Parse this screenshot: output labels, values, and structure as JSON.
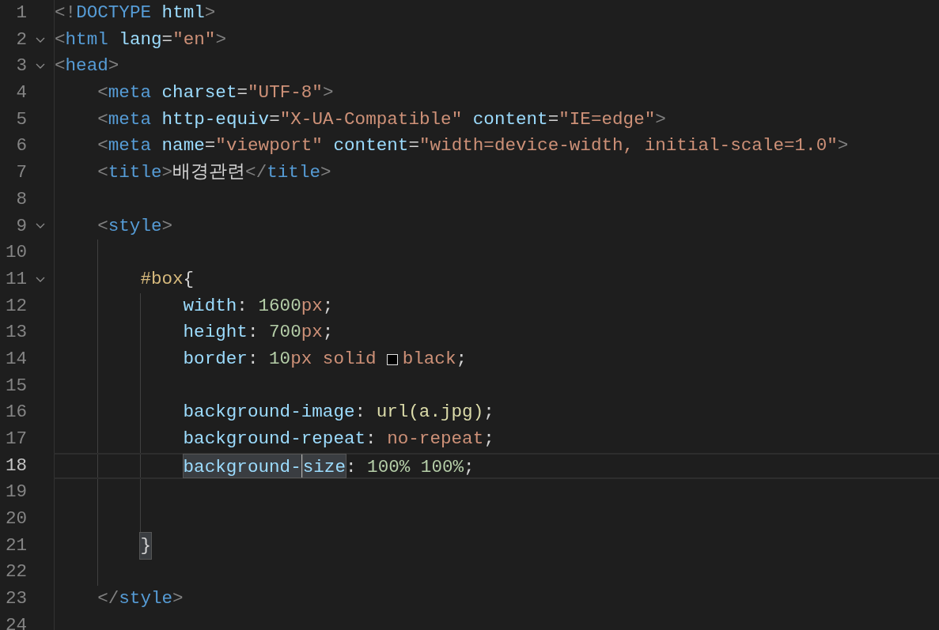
{
  "editor": {
    "lines": [
      {
        "number": "1",
        "selected": false,
        "tokens": [
          {
            "text": "<!",
            "kind": "punct"
          },
          {
            "text": "DOCTYPE",
            "kind": "tag"
          },
          {
            "text": " html",
            "kind": "attr"
          },
          {
            "text": ">",
            "kind": "punct"
          }
        ]
      },
      {
        "number": "2",
        "foldable": true,
        "selected": false,
        "tokens": [
          {
            "text": "<",
            "kind": "punct"
          },
          {
            "text": "html",
            "kind": "tag"
          },
          {
            "text": " lang",
            "kind": "attr"
          },
          {
            "text": "=",
            "kind": "text"
          },
          {
            "text": "\"en\"",
            "kind": "string"
          },
          {
            "text": ">",
            "kind": "punct"
          }
        ]
      },
      {
        "number": "3",
        "foldable": true,
        "selected": false,
        "tokens": [
          {
            "text": "<",
            "kind": "punct"
          },
          {
            "text": "head",
            "kind": "tag"
          },
          {
            "text": ">",
            "kind": "punct"
          }
        ],
        "children": [
          {
            "number": "4",
            "selected": false,
            "tokens": [
              {
                "text": "<",
                "kind": "punct"
              },
              {
                "text": "meta",
                "kind": "tag"
              },
              {
                "text": " charset",
                "kind": "attr"
              },
              {
                "text": "=",
                "kind": "text"
              },
              {
                "text": "\"UTF-8\"",
                "kind": "string"
              },
              {
                "text": ">",
                "kind": "punct"
              }
            ]
          },
          {
            "number": "5",
            "selected": false,
            "tokens": [
              {
                "text": "<",
                "kind": "punct"
              },
              {
                "text": "meta",
                "kind": "tag"
              },
              {
                "text": " http-equiv",
                "kind": "attr"
              },
              {
                "text": "=",
                "kind": "text"
              },
              {
                "text": "\"X-UA-Compatible\"",
                "kind": "string"
              },
              {
                "text": " content",
                "kind": "attr"
              },
              {
                "text": "=",
                "kind": "text"
              },
              {
                "text": "\"IE=edge\"",
                "kind": "string"
              },
              {
                "text": ">",
                "kind": "punct"
              }
            ]
          },
          {
            "number": "6",
            "selected": false,
            "tokens": [
              {
                "text": "<",
                "kind": "punct"
              },
              {
                "text": "meta",
                "kind": "tag"
              },
              {
                "text": " name",
                "kind": "attr"
              },
              {
                "text": "=",
                "kind": "text"
              },
              {
                "text": "\"viewport\"",
                "kind": "string"
              },
              {
                "text": " content",
                "kind": "attr"
              },
              {
                "text": "=",
                "kind": "text"
              },
              {
                "text": "\"width=device-width, initial-scale=1.0\"",
                "kind": "string"
              },
              {
                "text": ">",
                "kind": "punct"
              }
            ]
          },
          {
            "number": "7",
            "selected": false,
            "tokens": [
              {
                "text": "<",
                "kind": "punct"
              },
              {
                "text": "title",
                "kind": "tag"
              },
              {
                "text": ">",
                "kind": "punct"
              },
              {
                "text": "배경관련",
                "kind": "text"
              },
              {
                "text": "</",
                "kind": "punct"
              },
              {
                "text": "title",
                "kind": "tag"
              },
              {
                "text": ">",
                "kind": "punct"
              }
            ]
          },
          {
            "number": "8",
            "selected": false
          },
          {
            "number": "9",
            "foldable": true,
            "selected": false,
            "tokens": [
              {
                "text": "<",
                "kind": "punct"
              },
              {
                "text": "style",
                "kind": "tag"
              },
              {
                "text": ">",
                "kind": "punct"
              }
            ],
            "children": [
              {
                "number": "10",
                "selected": false
              },
              {
                "number": "11",
                "foldable": true,
                "selected": false,
                "tokens": [
                  {
                    "text": "#box",
                    "kind": "selector"
                  },
                  {
                    "text": "{",
                    "kind": "text"
                  }
                ],
                "children": [
                  {
                    "number": "12",
                    "selected": false,
                    "tokens": [
                      {
                        "text": "width",
                        "kind": "attr"
                      },
                      {
                        "text": ": ",
                        "kind": "text"
                      },
                      {
                        "text": "1600",
                        "kind": "number"
                      },
                      {
                        "text": "px",
                        "kind": "value"
                      },
                      {
                        "text": ";",
                        "kind": "text"
                      }
                    ]
                  },
                  {
                    "number": "13",
                    "selected": false,
                    "tokens": [
                      {
                        "text": "height",
                        "kind": "attr"
                      },
                      {
                        "text": ": ",
                        "kind": "text"
                      },
                      {
                        "text": "700",
                        "kind": "number"
                      },
                      {
                        "text": "px",
                        "kind": "value"
                      },
                      {
                        "text": ";",
                        "kind": "text"
                      }
                    ]
                  },
                  {
                    "number": "14",
                    "selected": false,
                    "tokens": [
                      {
                        "text": "border",
                        "kind": "attr"
                      },
                      {
                        "text": ": ",
                        "kind": "text"
                      },
                      {
                        "text": "10",
                        "kind": "number"
                      },
                      {
                        "text": "px",
                        "kind": "value"
                      },
                      {
                        "text": " solid",
                        "kind": "value"
                      },
                      {
                        "kind": "swatch",
                        "color": "#000000"
                      },
                      {
                        "text": "black",
                        "kind": "value"
                      },
                      {
                        "text": ";",
                        "kind": "text"
                      }
                    ]
                  },
                  {
                    "number": "15",
                    "selected": false
                  },
                  {
                    "number": "16",
                    "selected": false,
                    "tokens": [
                      {
                        "text": "background-image",
                        "kind": "attr"
                      },
                      {
                        "text": ": ",
                        "kind": "text"
                      },
                      {
                        "text": "url(a.jpg)",
                        "kind": "func"
                      },
                      {
                        "text": ";",
                        "kind": "text"
                      }
                    ]
                  },
                  {
                    "number": "17",
                    "selected": false,
                    "tokens": [
                      {
                        "text": "background-repeat",
                        "kind": "attr"
                      },
                      {
                        "text": ": ",
                        "kind": "text"
                      },
                      {
                        "text": "no-repeat",
                        "kind": "value"
                      },
                      {
                        "text": ";",
                        "kind": "text"
                      }
                    ]
                  },
                  {
                    "number": "18",
                    "selected": true,
                    "tokens": [
                      {
                        "text": "background-",
                        "kind": "attr",
                        "highlighted": true
                      },
                      {
                        "kind": "cursor"
                      },
                      {
                        "text": "size",
                        "kind": "attr",
                        "highlighted": true
                      },
                      {
                        "text": ": ",
                        "kind": "text"
                      },
                      {
                        "text": "100%",
                        "kind": "number"
                      },
                      {
                        "text": " 100%",
                        "kind": "number"
                      },
                      {
                        "text": ";",
                        "kind": "text"
                      }
                    ]
                  },
                  {
                    "number": "19",
                    "selected": false
                  },
                  {
                    "number": "20",
                    "selected": false
                  }
                ]
              },
              {
                "number": "21",
                "selected": false,
                "tokens": [
                  {
                    "text": "}",
                    "kind": "text",
                    "highlighted": true
                  }
                ]
              },
              {
                "number": "22",
                "selected": false
              }
            ]
          },
          {
            "number": "23",
            "selected": false,
            "tokens": [
              {
                "text": "</",
                "kind": "punct"
              },
              {
                "text": "style",
                "kind": "tag"
              },
              {
                "text": ">",
                "kind": "punct"
              }
            ]
          }
        ]
      },
      {
        "number": "24",
        "selected": false
      }
    ]
  }
}
